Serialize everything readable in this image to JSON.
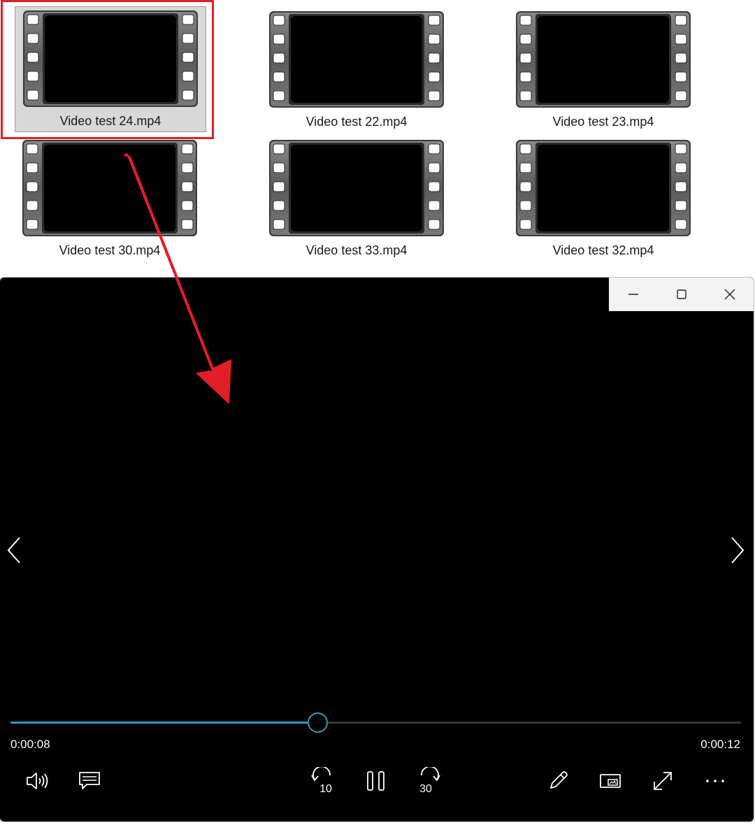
{
  "files": [
    {
      "name": "Video test 24.mp4",
      "selected": true
    },
    {
      "name": "Video test 22.mp4",
      "selected": false
    },
    {
      "name": "Video test 23.mp4",
      "selected": false
    },
    {
      "name": "Video test 30.mp4",
      "selected": false
    },
    {
      "name": "Video test 33.mp4",
      "selected": false
    },
    {
      "name": "Video test 32.mp4",
      "selected": false
    }
  ],
  "player": {
    "elapsed": "0:00:08",
    "total": "0:00:12",
    "progress_fraction": 0.42
  },
  "colors": {
    "accent": "#3399b5",
    "annotation": "#e21f26",
    "selection_bg": "#d8d8d8"
  },
  "icons": {
    "minimize": "minimize-icon",
    "maximize": "maximize-icon",
    "close": "close-icon",
    "volume": "volume-icon",
    "subtitles": "subtitles-icon",
    "skip_back": "skip-back-10-icon",
    "pause": "pause-icon",
    "skip_forward": "skip-forward-30-icon",
    "edit": "pencil-icon",
    "mini_view": "mini-view-icon",
    "fullscreen": "fullscreen-icon",
    "more": "more-options-icon"
  },
  "skip_back_label": "10",
  "skip_forward_label": "30"
}
